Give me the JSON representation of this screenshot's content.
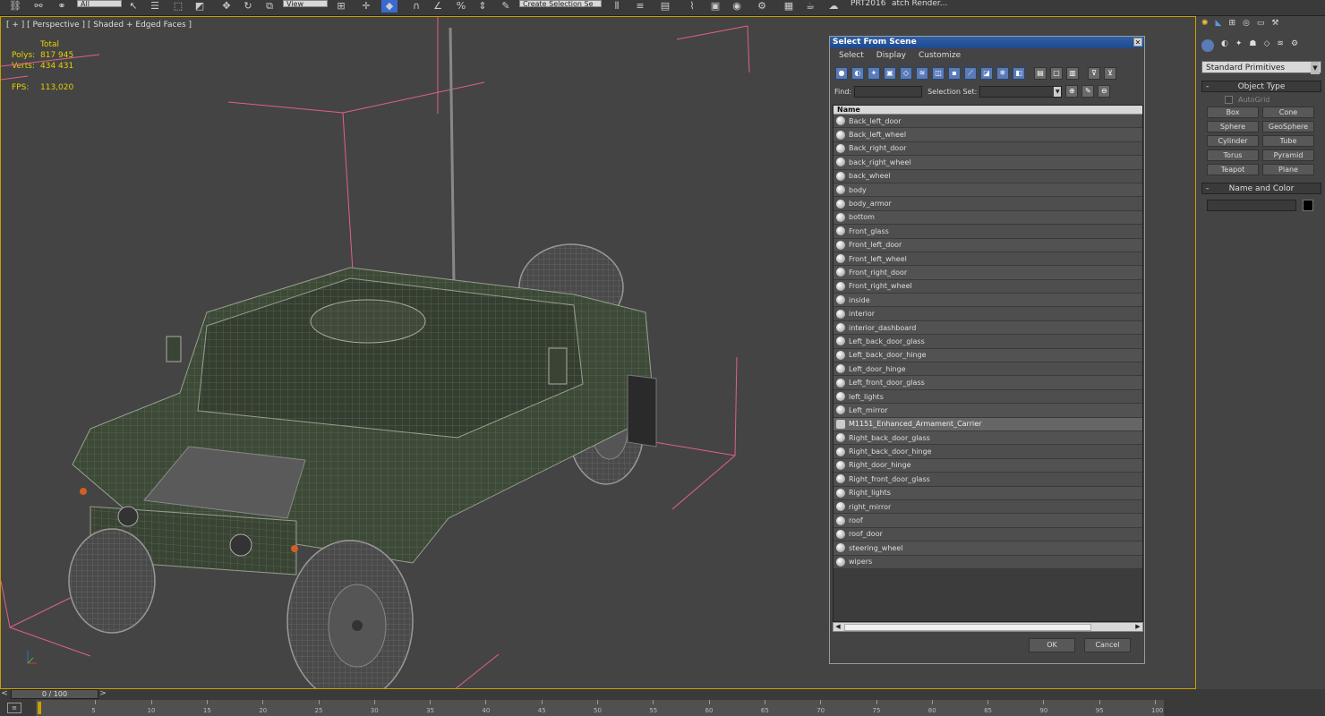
{
  "toolbar": {
    "named_selection_placeholder": "Create Selection Se",
    "view_dropdown": "View",
    "filter_dropdown": "All",
    "workspace_label": "PRT2016",
    "batch_render": "atch Render..."
  },
  "viewport": {
    "label": "[ + ] [ Perspective ] [ Shaded + Edged Faces ]",
    "stats": {
      "total_label": "Total",
      "polys_label": "Polys:",
      "polys": "817 945",
      "verts_label": "Verts:",
      "verts": "434 431",
      "fps_label": "FPS:",
      "fps": "113,020"
    }
  },
  "command_panel": {
    "category": "Standard Primitives",
    "object_type_title": "Object Type",
    "autogrid_label": "AutoGrid",
    "object_buttons": [
      "Box",
      "Cone",
      "Sphere",
      "GeoSphere",
      "Cylinder",
      "Tube",
      "Torus",
      "Pyramid",
      "Teapot",
      "Plane"
    ],
    "name_color_title": "Name and Color"
  },
  "dialog": {
    "title": "Select From Scene",
    "menu": [
      "Select",
      "Display",
      "Customize"
    ],
    "find_label": "Find:",
    "selection_set_label": "Selection Set:",
    "column_name": "Name",
    "items": [
      "Back_left_door",
      "Back_left_wheel",
      "Back_right_door",
      "back_right_wheel",
      "back_wheel",
      "body",
      "body_armor",
      "bottom",
      "Front_glass",
      "Front_left_door",
      "Front_left_wheel",
      "Front_right_door",
      "Front_right_wheel",
      "inside",
      "interior",
      "interior_dashboard",
      "Left_back_door_glass",
      "Left_back_door_hinge",
      "Left_door_hinge",
      "Left_front_door_glass",
      "left_lights",
      "Left_mirror",
      "M1151_Enhanced_Armament_Carrier",
      "Right_back_door_glass",
      "Right_back_door_hinge",
      "Right_door_hinge",
      "Right_front_door_glass",
      "Right_lights",
      "right_mirror",
      "roof",
      "roof_door",
      "steering_wheel",
      "wipers"
    ],
    "group_item": "M1151_Enhanced_Armament_Carrier",
    "ok_label": "OK",
    "cancel_label": "Cancel"
  },
  "timeline": {
    "frame_display": "0 / 100",
    "ticks": [
      "5",
      "10",
      "15",
      "20",
      "25",
      "30",
      "35",
      "40",
      "45",
      "50",
      "55",
      "60",
      "65",
      "70",
      "75",
      "80",
      "85",
      "90",
      "95",
      "100"
    ]
  },
  "colors": {
    "accent_yellow": "#e8d000",
    "bbox_pink": "#e0608c",
    "mesh_green": "#3e4a38",
    "title_blue": "#1e4a8c"
  }
}
